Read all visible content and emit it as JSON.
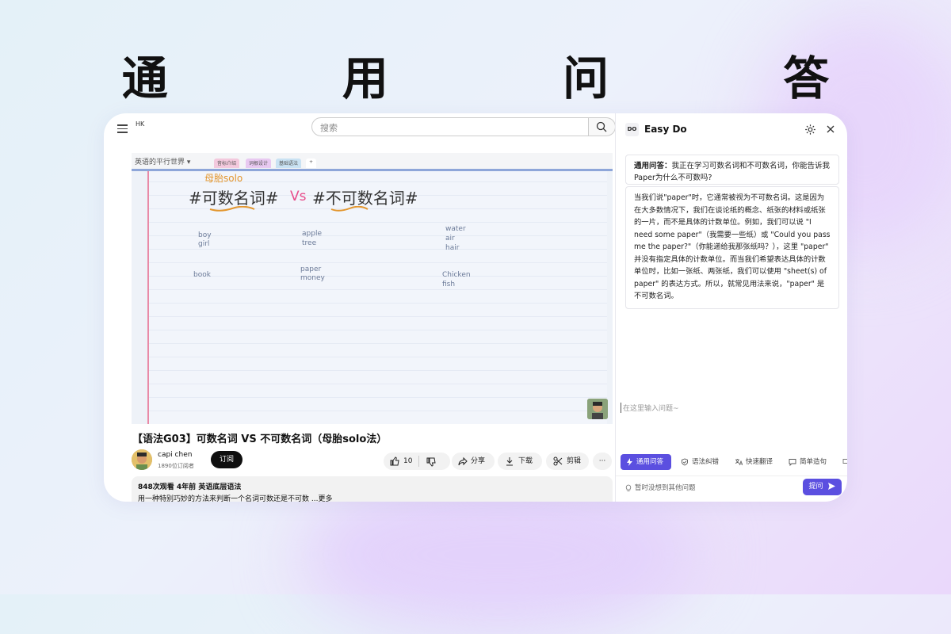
{
  "headline": "通 用 问 答",
  "youtube": {
    "logo_text": "HK",
    "search_placeholder": "搜索",
    "video_notebook_title": "英语的平行世界 ▾",
    "video_tabs": [
      "音标介绍",
      "词根设计",
      "基础语法",
      "+"
    ],
    "video_handwriting": {
      "note": "母胎solo",
      "heading_left": "#可数名词#",
      "vs": "Vs",
      "heading_right": "#不可数名词#"
    },
    "video_words": {
      "col1": [
        "boy",
        "girl",
        "book"
      ],
      "col2": [
        "apple",
        "tree",
        "paper",
        "money"
      ],
      "col3": [
        "water",
        "air",
        "hair",
        "Chicken",
        "fish"
      ]
    },
    "video_title": "【语法G03】可数名词 VS 不可数名词（母胎solo法）",
    "channel_name": "capi chen",
    "channel_subs": "1890位订阅者",
    "subscribe_label": "订阅",
    "like_count": "10",
    "share_label": "分享",
    "download_label": "下载",
    "clip_label": "剪辑",
    "more_label": "···",
    "desc_meta": "848次观看  4年前  英语底层语法",
    "desc_text": "用一种特别巧妙的方法来判断一个名词可数还是不可数 ...更多"
  },
  "panel": {
    "logo": "DO",
    "title": "Easy Do",
    "question_label": "通用问答：",
    "question_text": "我正在学习可数名词和不可数名词，你能告诉我Paper为什么不可数吗?",
    "answer_text": "当我们说\"paper\"时，它通常被视为不可数名词。这是因为在大多数情况下，我们在谈论纸的概念、纸张的材料或纸张的一片，而不是具体的计数单位。例如，我们可以说 \"I need some paper\"（我需要一些纸）或 \"Could you pass me the paper?\"（你能递给我那张纸吗？），这里 \"paper\" 并没有指定具体的计数单位。而当我们希望表达具体的计数单位时，比如一张纸、两张纸，我们可以使用 \"sheet(s) of paper\" 的表达方式。所以，就常见用法来说，\"paper\" 是不可数名词。",
    "input_placeholder": "在这里输入问题~",
    "chips": [
      "通用问答",
      "语法纠错",
      "快速翻译",
      "简单造句"
    ],
    "hint": "暂时没想到其他问题",
    "ask_label": "提问"
  },
  "colors": {
    "accent": "#5b4fe0",
    "subscribe": "#0f0f0f",
    "handwriting_orange": "#e3962e",
    "handwriting_pink": "#e84b8a"
  }
}
